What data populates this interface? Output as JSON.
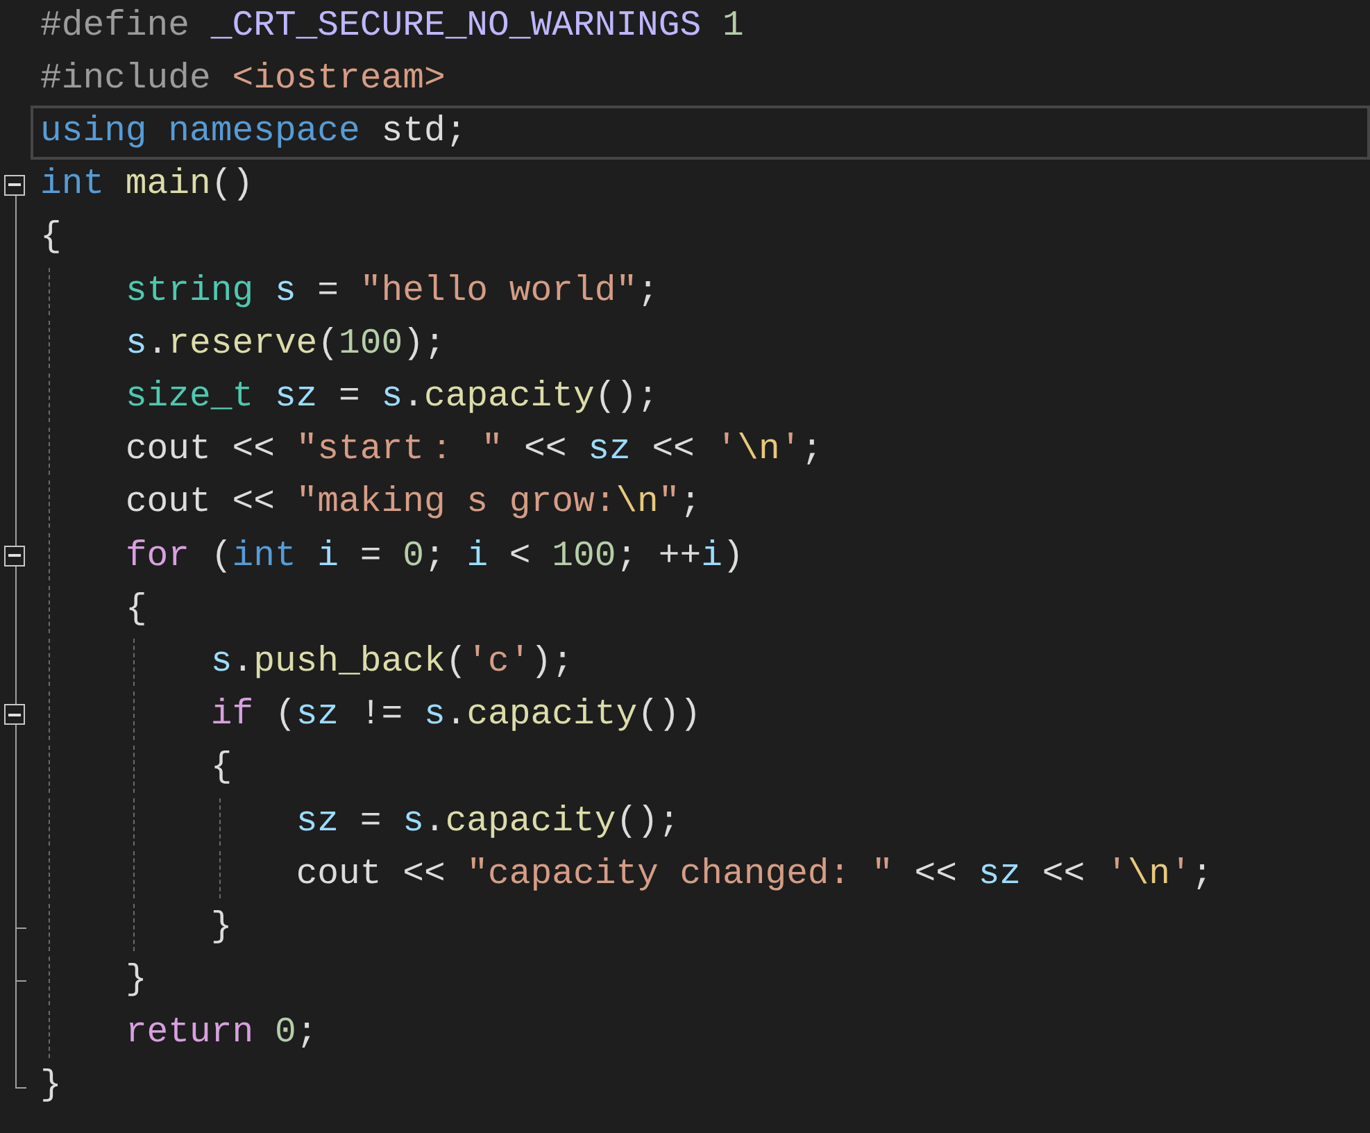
{
  "editor": {
    "lines": [
      {
        "tokens": [
          {
            "text": "#define",
            "kind": "preprocessor"
          },
          {
            "text": " _CRT_SECURE_NO_WARNINGS",
            "kind": "macro"
          },
          {
            "text": " 1",
            "kind": "number"
          }
        ]
      },
      {
        "tokens": [
          {
            "text": "#include",
            "kind": "preprocessor"
          },
          {
            "text": " <iostream>",
            "kind": "string"
          }
        ]
      },
      {
        "current": true,
        "tokens": [
          {
            "text": "using",
            "kind": "keyword"
          },
          {
            "text": " namespace",
            "kind": "keyword"
          },
          {
            "text": " std;",
            "kind": "plain"
          }
        ]
      },
      {
        "fold_start": true,
        "tokens": [
          {
            "text": "int",
            "kind": "keyword"
          },
          {
            "text": " main",
            "kind": "function"
          },
          {
            "text": "()",
            "kind": "plain"
          }
        ]
      },
      {
        "tokens": [
          {
            "text": "{",
            "kind": "plain"
          }
        ],
        "children": [
          {
            "tokens": [
              {
                "text": "string",
                "kind": "type"
              },
              {
                "text": " s",
                "kind": "variable"
              },
              {
                "text": " = ",
                "kind": "plain"
              },
              {
                "text": "\"hello world\"",
                "kind": "string"
              },
              {
                "text": ";",
                "kind": "plain"
              }
            ]
          },
          {
            "tokens": [
              {
                "text": "s",
                "kind": "variable"
              },
              {
                "text": ".",
                "kind": "plain"
              },
              {
                "text": "reserve",
                "kind": "function"
              },
              {
                "text": "(",
                "kind": "plain"
              },
              {
                "text": "100",
                "kind": "number"
              },
              {
                "text": ");",
                "kind": "plain"
              }
            ]
          },
          {
            "tokens": [
              {
                "text": "size_t",
                "kind": "type"
              },
              {
                "text": " sz",
                "kind": "variable"
              },
              {
                "text": " = ",
                "kind": "plain"
              },
              {
                "text": "s",
                "kind": "variable"
              },
              {
                "text": ".",
                "kind": "plain"
              },
              {
                "text": "capacity",
                "kind": "function"
              },
              {
                "text": "();",
                "kind": "plain"
              }
            ]
          },
          {
            "tokens": [
              {
                "text": "cout << ",
                "kind": "plain"
              },
              {
                "text": "\"start： \"",
                "kind": "string"
              },
              {
                "text": " << ",
                "kind": "plain"
              },
              {
                "text": "sz",
                "kind": "variable"
              },
              {
                "text": " << ",
                "kind": "plain"
              },
              {
                "text": "'",
                "kind": "string"
              },
              {
                "text": "\\n",
                "kind": "escape"
              },
              {
                "text": "'",
                "kind": "string"
              },
              {
                "text": ";",
                "kind": "plain"
              }
            ]
          },
          {
            "tokens": [
              {
                "text": "cout << ",
                "kind": "plain"
              },
              {
                "text": "\"making s grow:",
                "kind": "string"
              },
              {
                "text": "\\n",
                "kind": "escape"
              },
              {
                "text": "\"",
                "kind": "string"
              },
              {
                "text": ";",
                "kind": "plain"
              }
            ]
          },
          {
            "fold_start": true,
            "tokens": [
              {
                "text": "for",
                "kind": "control"
              },
              {
                "text": " (",
                "kind": "plain"
              },
              {
                "text": "int",
                "kind": "keyword"
              },
              {
                "text": " i",
                "kind": "variable"
              },
              {
                "text": " = ",
                "kind": "plain"
              },
              {
                "text": "0",
                "kind": "number"
              },
              {
                "text": "; ",
                "kind": "plain"
              },
              {
                "text": "i",
                "kind": "variable"
              },
              {
                "text": " < ",
                "kind": "plain"
              },
              {
                "text": "100",
                "kind": "number"
              },
              {
                "text": "; ++",
                "kind": "plain"
              },
              {
                "text": "i",
                "kind": "variable"
              },
              {
                "text": ")",
                "kind": "plain"
              }
            ]
          },
          {
            "tokens": [
              {
                "text": "{",
                "kind": "plain"
              }
            ],
            "children": [
              {
                "tokens": [
                  {
                    "text": "s",
                    "kind": "variable"
                  },
                  {
                    "text": ".",
                    "kind": "plain"
                  },
                  {
                    "text": "push_back",
                    "kind": "function"
                  },
                  {
                    "text": "(",
                    "kind": "plain"
                  },
                  {
                    "text": "'c'",
                    "kind": "string"
                  },
                  {
                    "text": ");",
                    "kind": "plain"
                  }
                ]
              },
              {
                "fold_start": true,
                "tokens": [
                  {
                    "text": "if",
                    "kind": "control"
                  },
                  {
                    "text": " (",
                    "kind": "plain"
                  },
                  {
                    "text": "sz",
                    "kind": "variable"
                  },
                  {
                    "text": " != ",
                    "kind": "plain"
                  },
                  {
                    "text": "s",
                    "kind": "variable"
                  },
                  {
                    "text": ".",
                    "kind": "plain"
                  },
                  {
                    "text": "capacity",
                    "kind": "function"
                  },
                  {
                    "text": "())",
                    "kind": "plain"
                  }
                ]
              },
              {
                "tokens": [
                  {
                    "text": "{",
                    "kind": "plain"
                  }
                ],
                "children": [
                  {
                    "tokens": [
                      {
                        "text": "sz",
                        "kind": "variable"
                      },
                      {
                        "text": " = ",
                        "kind": "plain"
                      },
                      {
                        "text": "s",
                        "kind": "variable"
                      },
                      {
                        "text": ".",
                        "kind": "plain"
                      },
                      {
                        "text": "capacity",
                        "kind": "function"
                      },
                      {
                        "text": "();",
                        "kind": "plain"
                      }
                    ]
                  },
                  {
                    "tokens": [
                      {
                        "text": "cout << ",
                        "kind": "plain"
                      },
                      {
                        "text": "\"capacity changed: \"",
                        "kind": "string"
                      },
                      {
                        "text": " << ",
                        "kind": "plain"
                      },
                      {
                        "text": "sz",
                        "kind": "variable"
                      },
                      {
                        "text": " << ",
                        "kind": "plain"
                      },
                      {
                        "text": "'",
                        "kind": "string"
                      },
                      {
                        "text": "\\n",
                        "kind": "escape"
                      },
                      {
                        "text": "'",
                        "kind": "string"
                      },
                      {
                        "text": ";",
                        "kind": "plain"
                      }
                    ]
                  }
                ]
              },
              {
                "fold_end": true,
                "tokens": [
                  {
                    "text": "}",
                    "kind": "plain"
                  }
                ]
              }
            ]
          },
          {
            "fold_end": true,
            "tokens": [
              {
                "text": "}",
                "kind": "plain"
              }
            ]
          },
          {
            "tokens": [
              {
                "text": "return",
                "kind": "control"
              },
              {
                "text": " 0",
                "kind": "number"
              },
              {
                "text": ";",
                "kind": "plain"
              }
            ]
          }
        ]
      },
      {
        "fold_end": true,
        "tokens": [
          {
            "text": "}",
            "kind": "plain"
          }
        ]
      }
    ]
  }
}
